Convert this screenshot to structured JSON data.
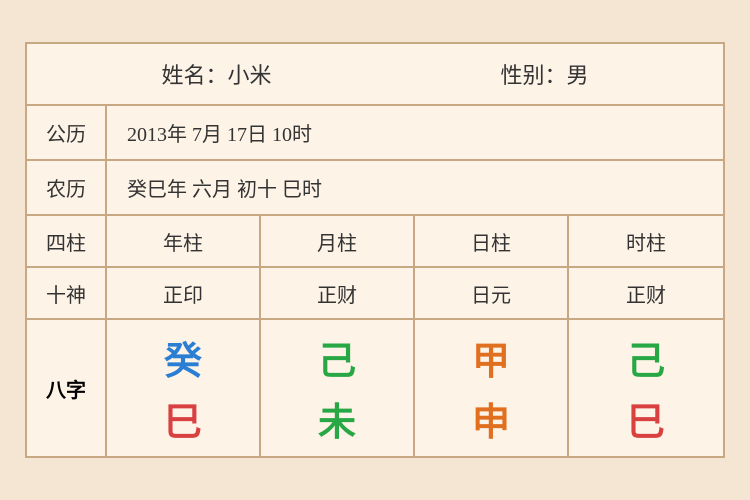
{
  "header": {
    "name_label": "姓名：小米",
    "gender_label": "性别：男"
  },
  "solar": {
    "label": "公历",
    "value": "2013年 7月 17日 10时"
  },
  "lunar": {
    "label": "农历",
    "value": "癸巳年 六月 初十 巳时"
  },
  "columns": {
    "label": "四柱",
    "year": "年柱",
    "month": "月柱",
    "day": "日柱",
    "hour": "时柱"
  },
  "shishen": {
    "label": "十神",
    "year": "正印",
    "month": "正财",
    "day": "日元",
    "hour": "正财"
  },
  "bazi": {
    "label": "八字",
    "year_top": "癸",
    "year_bottom": "巳",
    "month_top": "己",
    "month_bottom": "未",
    "day_top": "甲",
    "day_bottom": "申",
    "hour_top": "己",
    "hour_bottom": "巳"
  }
}
